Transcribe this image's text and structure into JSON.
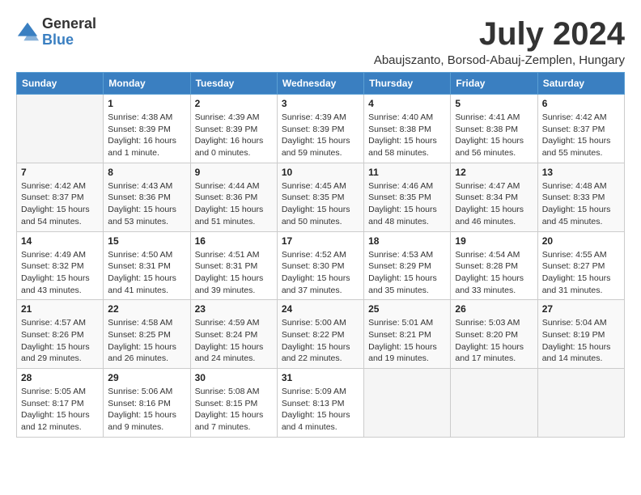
{
  "logo": {
    "general": "General",
    "blue": "Blue"
  },
  "header": {
    "month_year": "July 2024",
    "location": "Abaujszanto, Borsod-Abauj-Zemplen, Hungary"
  },
  "days_of_week": [
    "Sunday",
    "Monday",
    "Tuesday",
    "Wednesday",
    "Thursday",
    "Friday",
    "Saturday"
  ],
  "weeks": [
    [
      {
        "day": "",
        "sunrise": "",
        "sunset": "",
        "daylight": ""
      },
      {
        "day": "1",
        "sunrise": "Sunrise: 4:38 AM",
        "sunset": "Sunset: 8:39 PM",
        "daylight": "Daylight: 16 hours and 1 minute."
      },
      {
        "day": "2",
        "sunrise": "Sunrise: 4:39 AM",
        "sunset": "Sunset: 8:39 PM",
        "daylight": "Daylight: 16 hours and 0 minutes."
      },
      {
        "day": "3",
        "sunrise": "Sunrise: 4:39 AM",
        "sunset": "Sunset: 8:39 PM",
        "daylight": "Daylight: 15 hours and 59 minutes."
      },
      {
        "day": "4",
        "sunrise": "Sunrise: 4:40 AM",
        "sunset": "Sunset: 8:38 PM",
        "daylight": "Daylight: 15 hours and 58 minutes."
      },
      {
        "day": "5",
        "sunrise": "Sunrise: 4:41 AM",
        "sunset": "Sunset: 8:38 PM",
        "daylight": "Daylight: 15 hours and 56 minutes."
      },
      {
        "day": "6",
        "sunrise": "Sunrise: 4:42 AM",
        "sunset": "Sunset: 8:37 PM",
        "daylight": "Daylight: 15 hours and 55 minutes."
      }
    ],
    [
      {
        "day": "7",
        "sunrise": "Sunrise: 4:42 AM",
        "sunset": "Sunset: 8:37 PM",
        "daylight": "Daylight: 15 hours and 54 minutes."
      },
      {
        "day": "8",
        "sunrise": "Sunrise: 4:43 AM",
        "sunset": "Sunset: 8:36 PM",
        "daylight": "Daylight: 15 hours and 53 minutes."
      },
      {
        "day": "9",
        "sunrise": "Sunrise: 4:44 AM",
        "sunset": "Sunset: 8:36 PM",
        "daylight": "Daylight: 15 hours and 51 minutes."
      },
      {
        "day": "10",
        "sunrise": "Sunrise: 4:45 AM",
        "sunset": "Sunset: 8:35 PM",
        "daylight": "Daylight: 15 hours and 50 minutes."
      },
      {
        "day": "11",
        "sunrise": "Sunrise: 4:46 AM",
        "sunset": "Sunset: 8:35 PM",
        "daylight": "Daylight: 15 hours and 48 minutes."
      },
      {
        "day": "12",
        "sunrise": "Sunrise: 4:47 AM",
        "sunset": "Sunset: 8:34 PM",
        "daylight": "Daylight: 15 hours and 46 minutes."
      },
      {
        "day": "13",
        "sunrise": "Sunrise: 4:48 AM",
        "sunset": "Sunset: 8:33 PM",
        "daylight": "Daylight: 15 hours and 45 minutes."
      }
    ],
    [
      {
        "day": "14",
        "sunrise": "Sunrise: 4:49 AM",
        "sunset": "Sunset: 8:32 PM",
        "daylight": "Daylight: 15 hours and 43 minutes."
      },
      {
        "day": "15",
        "sunrise": "Sunrise: 4:50 AM",
        "sunset": "Sunset: 8:31 PM",
        "daylight": "Daylight: 15 hours and 41 minutes."
      },
      {
        "day": "16",
        "sunrise": "Sunrise: 4:51 AM",
        "sunset": "Sunset: 8:31 PM",
        "daylight": "Daylight: 15 hours and 39 minutes."
      },
      {
        "day": "17",
        "sunrise": "Sunrise: 4:52 AM",
        "sunset": "Sunset: 8:30 PM",
        "daylight": "Daylight: 15 hours and 37 minutes."
      },
      {
        "day": "18",
        "sunrise": "Sunrise: 4:53 AM",
        "sunset": "Sunset: 8:29 PM",
        "daylight": "Daylight: 15 hours and 35 minutes."
      },
      {
        "day": "19",
        "sunrise": "Sunrise: 4:54 AM",
        "sunset": "Sunset: 8:28 PM",
        "daylight": "Daylight: 15 hours and 33 minutes."
      },
      {
        "day": "20",
        "sunrise": "Sunrise: 4:55 AM",
        "sunset": "Sunset: 8:27 PM",
        "daylight": "Daylight: 15 hours and 31 minutes."
      }
    ],
    [
      {
        "day": "21",
        "sunrise": "Sunrise: 4:57 AM",
        "sunset": "Sunset: 8:26 PM",
        "daylight": "Daylight: 15 hours and 29 minutes."
      },
      {
        "day": "22",
        "sunrise": "Sunrise: 4:58 AM",
        "sunset": "Sunset: 8:25 PM",
        "daylight": "Daylight: 15 hours and 26 minutes."
      },
      {
        "day": "23",
        "sunrise": "Sunrise: 4:59 AM",
        "sunset": "Sunset: 8:24 PM",
        "daylight": "Daylight: 15 hours and 24 minutes."
      },
      {
        "day": "24",
        "sunrise": "Sunrise: 5:00 AM",
        "sunset": "Sunset: 8:22 PM",
        "daylight": "Daylight: 15 hours and 22 minutes."
      },
      {
        "day": "25",
        "sunrise": "Sunrise: 5:01 AM",
        "sunset": "Sunset: 8:21 PM",
        "daylight": "Daylight: 15 hours and 19 minutes."
      },
      {
        "day": "26",
        "sunrise": "Sunrise: 5:03 AM",
        "sunset": "Sunset: 8:20 PM",
        "daylight": "Daylight: 15 hours and 17 minutes."
      },
      {
        "day": "27",
        "sunrise": "Sunrise: 5:04 AM",
        "sunset": "Sunset: 8:19 PM",
        "daylight": "Daylight: 15 hours and 14 minutes."
      }
    ],
    [
      {
        "day": "28",
        "sunrise": "Sunrise: 5:05 AM",
        "sunset": "Sunset: 8:17 PM",
        "daylight": "Daylight: 15 hours and 12 minutes."
      },
      {
        "day": "29",
        "sunrise": "Sunrise: 5:06 AM",
        "sunset": "Sunset: 8:16 PM",
        "daylight": "Daylight: 15 hours and 9 minutes."
      },
      {
        "day": "30",
        "sunrise": "Sunrise: 5:08 AM",
        "sunset": "Sunset: 8:15 PM",
        "daylight": "Daylight: 15 hours and 7 minutes."
      },
      {
        "day": "31",
        "sunrise": "Sunrise: 5:09 AM",
        "sunset": "Sunset: 8:13 PM",
        "daylight": "Daylight: 15 hours and 4 minutes."
      },
      {
        "day": "",
        "sunrise": "",
        "sunset": "",
        "daylight": ""
      },
      {
        "day": "",
        "sunrise": "",
        "sunset": "",
        "daylight": ""
      },
      {
        "day": "",
        "sunrise": "",
        "sunset": "",
        "daylight": ""
      }
    ]
  ]
}
